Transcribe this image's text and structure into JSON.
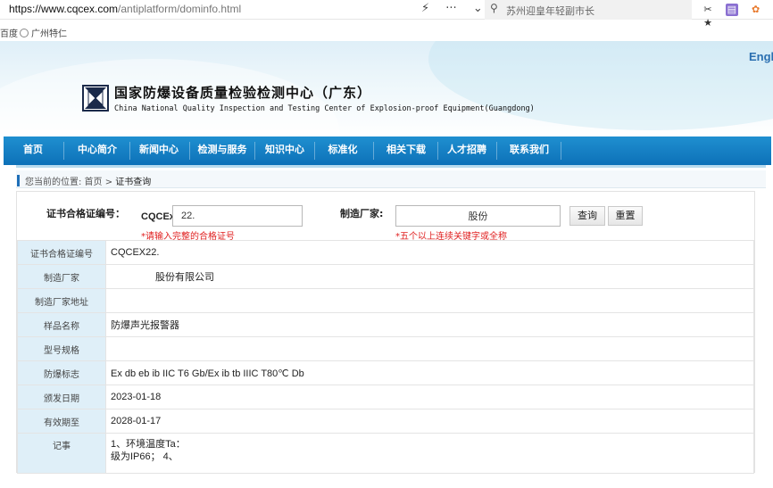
{
  "browser": {
    "url_scheme_host": "https://www.cqcex.com",
    "url_path": "/antiplatform/dominfo.html",
    "search_text": "苏州迎皇年轻副市长",
    "bookmarks": [
      "百度",
      "广州特仁"
    ]
  },
  "header": {
    "lang_link": "Engl",
    "org_name_cn": "国家防爆设备质量检验检测中心（广东）",
    "org_name_en": "China National Quality Inspection and Testing Center of Explosion-proof Equipment(Guangdong)"
  },
  "nav": [
    "首页",
    "中心简介",
    "新闻中心",
    "检测与服务",
    "知识中心",
    "标准化",
    "相关下载",
    "人才招聘",
    "联系我们"
  ],
  "breadcrumb": {
    "prefix": "您当前的位置: 首页 > ",
    "current": "证书查询"
  },
  "search": {
    "cert_label": "证书合格证编号：",
    "cert_prefix": "CQCEx",
    "cert_value": "22.",
    "cert_hint": "*请输入完整的合格证号",
    "mfr_label": "制造厂家:",
    "mfr_value": "股份",
    "mfr_hint": "*五个以上连续关键字或全称",
    "query_button": "查询",
    "reset_button": "重置"
  },
  "result": {
    "rows": [
      {
        "key": "证书合格证编号",
        "value": "CQCEX22."
      },
      {
        "key": "制造厂家",
        "value": "股份有限公司"
      },
      {
        "key": "制造厂家地址",
        "value": ""
      },
      {
        "key": "样品名称",
        "value": "防爆声光报警器"
      },
      {
        "key": "型号规格",
        "value": ""
      },
      {
        "key": "防爆标志",
        "value": "Ex db eb ib IIC T6 Gb/Ex ib tb IIIC T80℃ Db"
      },
      {
        "key": "颁发日期",
        "value": "2023-01-18"
      },
      {
        "key": "有效期至",
        "value": "2028-01-17"
      }
    ],
    "notes_key": "记事",
    "notes_line1": "1、环境温度Ta：",
    "notes_line2": "级为IP66； 4、"
  }
}
